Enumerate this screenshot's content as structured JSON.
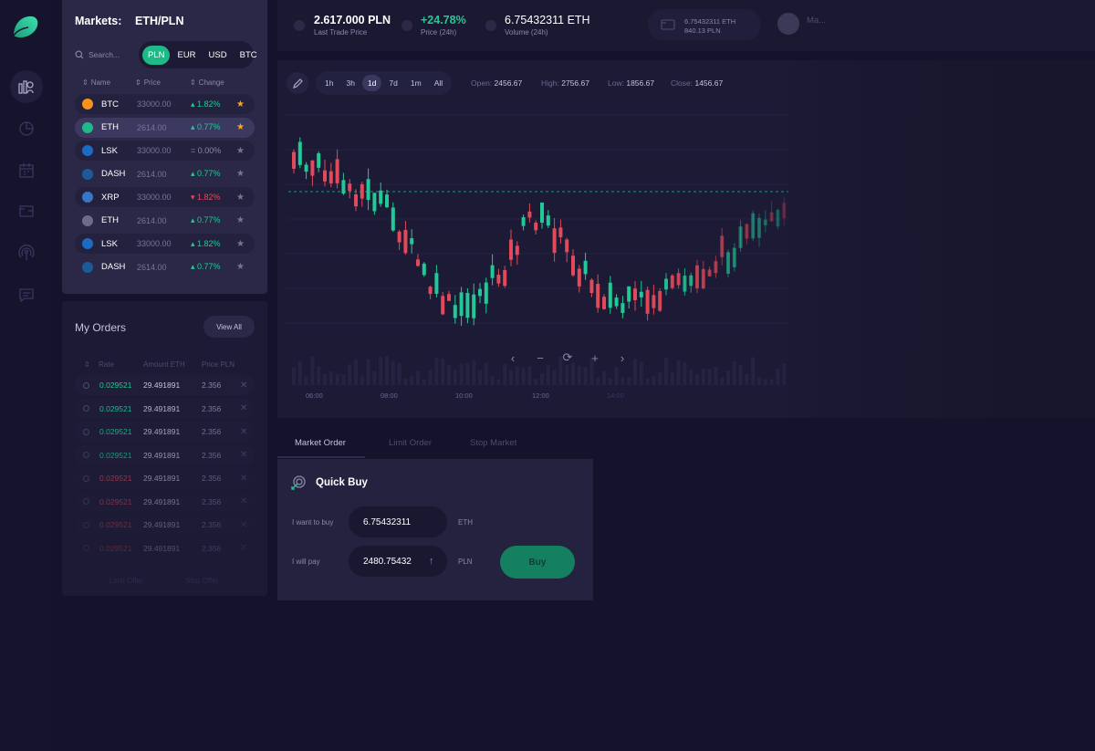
{
  "markets": {
    "label": "Markets:",
    "pair": "ETH/PLN",
    "search_placeholder": "Search...",
    "currencies": [
      "PLN",
      "EUR",
      "USD",
      "BTC"
    ],
    "active_currency": "PLN",
    "columns": [
      "Name",
      "Price",
      "Change"
    ],
    "coins": [
      {
        "name": "BTC",
        "price": "33000.00",
        "change": "1.82%",
        "trend": "up",
        "fav": true,
        "color": "#f7931a"
      },
      {
        "name": "ETH",
        "price": "2614.00",
        "change": "0.77%",
        "trend": "up",
        "fav": true,
        "color": "#1fb887"
      },
      {
        "name": "LSK",
        "price": "33000.00",
        "change": "0.00%",
        "trend": "flat",
        "fav": false,
        "color": "#1a6bc2"
      },
      {
        "name": "DASH",
        "price": "2614.00",
        "change": "0.77%",
        "trend": "up",
        "fav": false,
        "color": "#1c5a98"
      },
      {
        "name": "XRP",
        "price": "33000.00",
        "change": "1.82%",
        "trend": "down",
        "fav": false,
        "color": "#3a76c8"
      },
      {
        "name": "ETH",
        "price": "2614.00",
        "change": "0.77%",
        "trend": "up",
        "fav": false,
        "color": "#6e6c84"
      },
      {
        "name": "LSK",
        "price": "33000.00",
        "change": "1.82%",
        "trend": "up",
        "fav": false,
        "color": "#1a6bc2"
      },
      {
        "name": "DASH",
        "price": "2614.00",
        "change": "0.77%",
        "trend": "up",
        "fav": false,
        "color": "#1c5a98"
      }
    ]
  },
  "orders": {
    "title": "My Orders",
    "view_all": "View All",
    "columns": [
      "Rate",
      "Amount ETH",
      "Price PLN"
    ],
    "rows": [
      {
        "rate": "0.029521",
        "amount": "29.491891",
        "price": "2.356",
        "side": "buy"
      },
      {
        "rate": "0.029521",
        "amount": "29.491891",
        "price": "2.356",
        "side": "buy"
      },
      {
        "rate": "0.029521",
        "amount": "29.491891",
        "price": "2.356",
        "side": "buy"
      },
      {
        "rate": "0.029521",
        "amount": "29.491891",
        "price": "2.356",
        "side": "buy"
      },
      {
        "rate": "0.029521",
        "amount": "29.491891",
        "price": "2.356",
        "side": "sell"
      },
      {
        "rate": "0.029521",
        "amount": "29.491891",
        "price": "2.356",
        "side": "sell"
      },
      {
        "rate": "0.029521",
        "amount": "29.491891",
        "price": "2.356",
        "side": "sell"
      },
      {
        "rate": "0.029521",
        "amount": "29.491891",
        "price": "2.356",
        "side": "sell"
      }
    ],
    "footer_tabs": [
      "Limit Offer",
      "Stop Offer"
    ]
  },
  "ticker": {
    "last_trade": "2.617.000 PLN",
    "last_trade_label": "Last Trade Price",
    "change": "+24.78%",
    "change_label": "Price (24h)",
    "volume": "6.75432311 ETH",
    "volume_label": "Volume (24h)",
    "wallet_eth": "6.75432311 ETH",
    "wallet_pln": "840.13 PLN",
    "user_name": "Ma..."
  },
  "chart": {
    "timeframes": [
      "1h",
      "3h",
      "1d",
      "7d",
      "1m",
      "All"
    ],
    "active_timeframe": "1d",
    "open_label": "Open:",
    "open": "2456.67",
    "high_label": "High:",
    "high": "2756.67",
    "low_label": "Low:",
    "low": "1856.67",
    "close_label": "Close:",
    "close": "1456.67",
    "time_labels": [
      "06:00",
      "08:00",
      "10:00",
      "12:00",
      "14:00"
    ]
  },
  "chart_data": {
    "type": "candlestick",
    "up_color": "#22c997",
    "down_color": "#e04a5a"
  },
  "order_form": {
    "tabs": [
      "Market Order",
      "Limit Order",
      "Stop Market"
    ],
    "active_tab": "Market Order",
    "title": "Quick Buy",
    "want_label": "I want to buy",
    "want_value": "6.75432311",
    "want_unit": "ETH",
    "pay_label": "I will pay",
    "pay_value": "2480.75432",
    "pay_unit": "PLN",
    "buy_label": "Buy"
  },
  "colors": {
    "accent": "#1fb887",
    "up": "#22c997",
    "down": "#e04a5a",
    "favorite": "#f5a623"
  }
}
